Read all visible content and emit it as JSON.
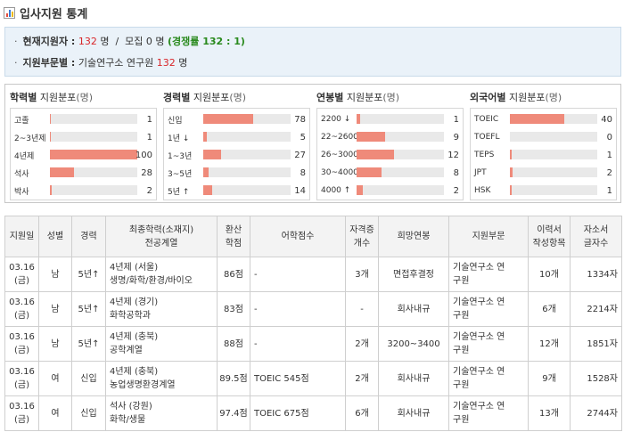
{
  "header": {
    "title": "입사지원 통계"
  },
  "summary": {
    "applicants_label": "현재지원자 :",
    "applicants_value": "132",
    "applicants_unit": "명",
    "separator": "/",
    "positions_label": "모집 0 명",
    "competition": "(경쟁률 132 : 1)",
    "dept_label": "지원부문별 :",
    "dept_text": "기술연구소 연구원",
    "dept_value": "132",
    "dept_unit": "명"
  },
  "distribution": [
    {
      "title_bold": "학력별",
      "title_rest": "지원분포",
      "unit": "(명)",
      "max": 100,
      "rows": [
        {
          "label": "고졸",
          "value": 1
        },
        {
          "label": "2~3년제",
          "value": 1
        },
        {
          "label": "4년제",
          "value": 100
        },
        {
          "label": "석사",
          "value": 28
        },
        {
          "label": "박사",
          "value": 2
        }
      ]
    },
    {
      "title_bold": "경력별",
      "title_rest": "지원분포",
      "unit": "(명)",
      "max": 136,
      "rows": [
        {
          "label": "신입",
          "value": 78
        },
        {
          "label": "1년 ↓",
          "value": 5
        },
        {
          "label": "1~3년",
          "value": 27
        },
        {
          "label": "3~5년",
          "value": 8
        },
        {
          "label": "5년 ↑",
          "value": 14
        }
      ]
    },
    {
      "title_bold": "연봉별",
      "title_rest": "지원분포",
      "unit": "(명)",
      "max": 28,
      "rows": [
        {
          "label": "2200 ↓",
          "value": 1
        },
        {
          "label": "22~2600",
          "value": 9
        },
        {
          "label": "26~3000",
          "value": 12
        },
        {
          "label": "30~4000",
          "value": 8
        },
        {
          "label": "4000 ↑",
          "value": 2
        }
      ]
    },
    {
      "title_bold": "외국어별",
      "title_rest": "지원분포",
      "unit": "(명)",
      "max": 64,
      "rows": [
        {
          "label": "TOEIC",
          "value": 40
        },
        {
          "label": "TOEFL",
          "value": 0
        },
        {
          "label": "TEPS",
          "value": 1
        },
        {
          "label": "JPT",
          "value": 2
        },
        {
          "label": "HSK",
          "value": 1
        }
      ]
    }
  ],
  "table": {
    "headers": [
      "지원일",
      "성별",
      "경력",
      "최종학력(소재지)\n전공계열",
      "환산\n학점",
      "어학점수",
      "자격증\n개수",
      "희망연봉",
      "지원부문",
      "이력서\n작성항목",
      "자소서\n글자수"
    ],
    "rows": [
      [
        "03.16\n(금)",
        "남",
        "5년↑",
        "4년제 (서울)\n생명/화학/환경/바이오",
        "86점",
        "-",
        "3개",
        "면접후결정",
        "기술연구소 연\n구원",
        "10개",
        "1334자"
      ],
      [
        "03.16\n(금)",
        "남",
        "5년↑",
        "4년제 (경기)\n화학공학과",
        "83점",
        "-",
        "-",
        "회사내규",
        "기술연구소 연\n구원",
        "6개",
        "2214자"
      ],
      [
        "03.16\n(금)",
        "남",
        "5년↑",
        "4년제 (충북)\n공학계열",
        "88점",
        "-",
        "2개",
        "3200~3400",
        "기술연구소 연\n구원",
        "12개",
        "1851자"
      ],
      [
        "03.16\n(금)",
        "여",
        "신입",
        "4년제 (충북)\n농업생명환경계열",
        "89.5점",
        "TOEIC 545점",
        "2개",
        "회사내규",
        "기술연구소 연\n구원",
        "9개",
        "1528자"
      ],
      [
        "03.16\n(금)",
        "여",
        "신입",
        "석사 (강원)\n화학/생물",
        "97.4점",
        "TOEIC 675점",
        "6개",
        "회사내규",
        "기술연구소 연\n구원",
        "13개",
        "2744자"
      ]
    ]
  },
  "colors": {
    "bar_fill": "#ef8a7a",
    "bar_track": "#e9e9e9",
    "highlight_red": "#d8262a",
    "highlight_green": "#2a8a1e",
    "summary_bg": "#eaf2f9"
  }
}
